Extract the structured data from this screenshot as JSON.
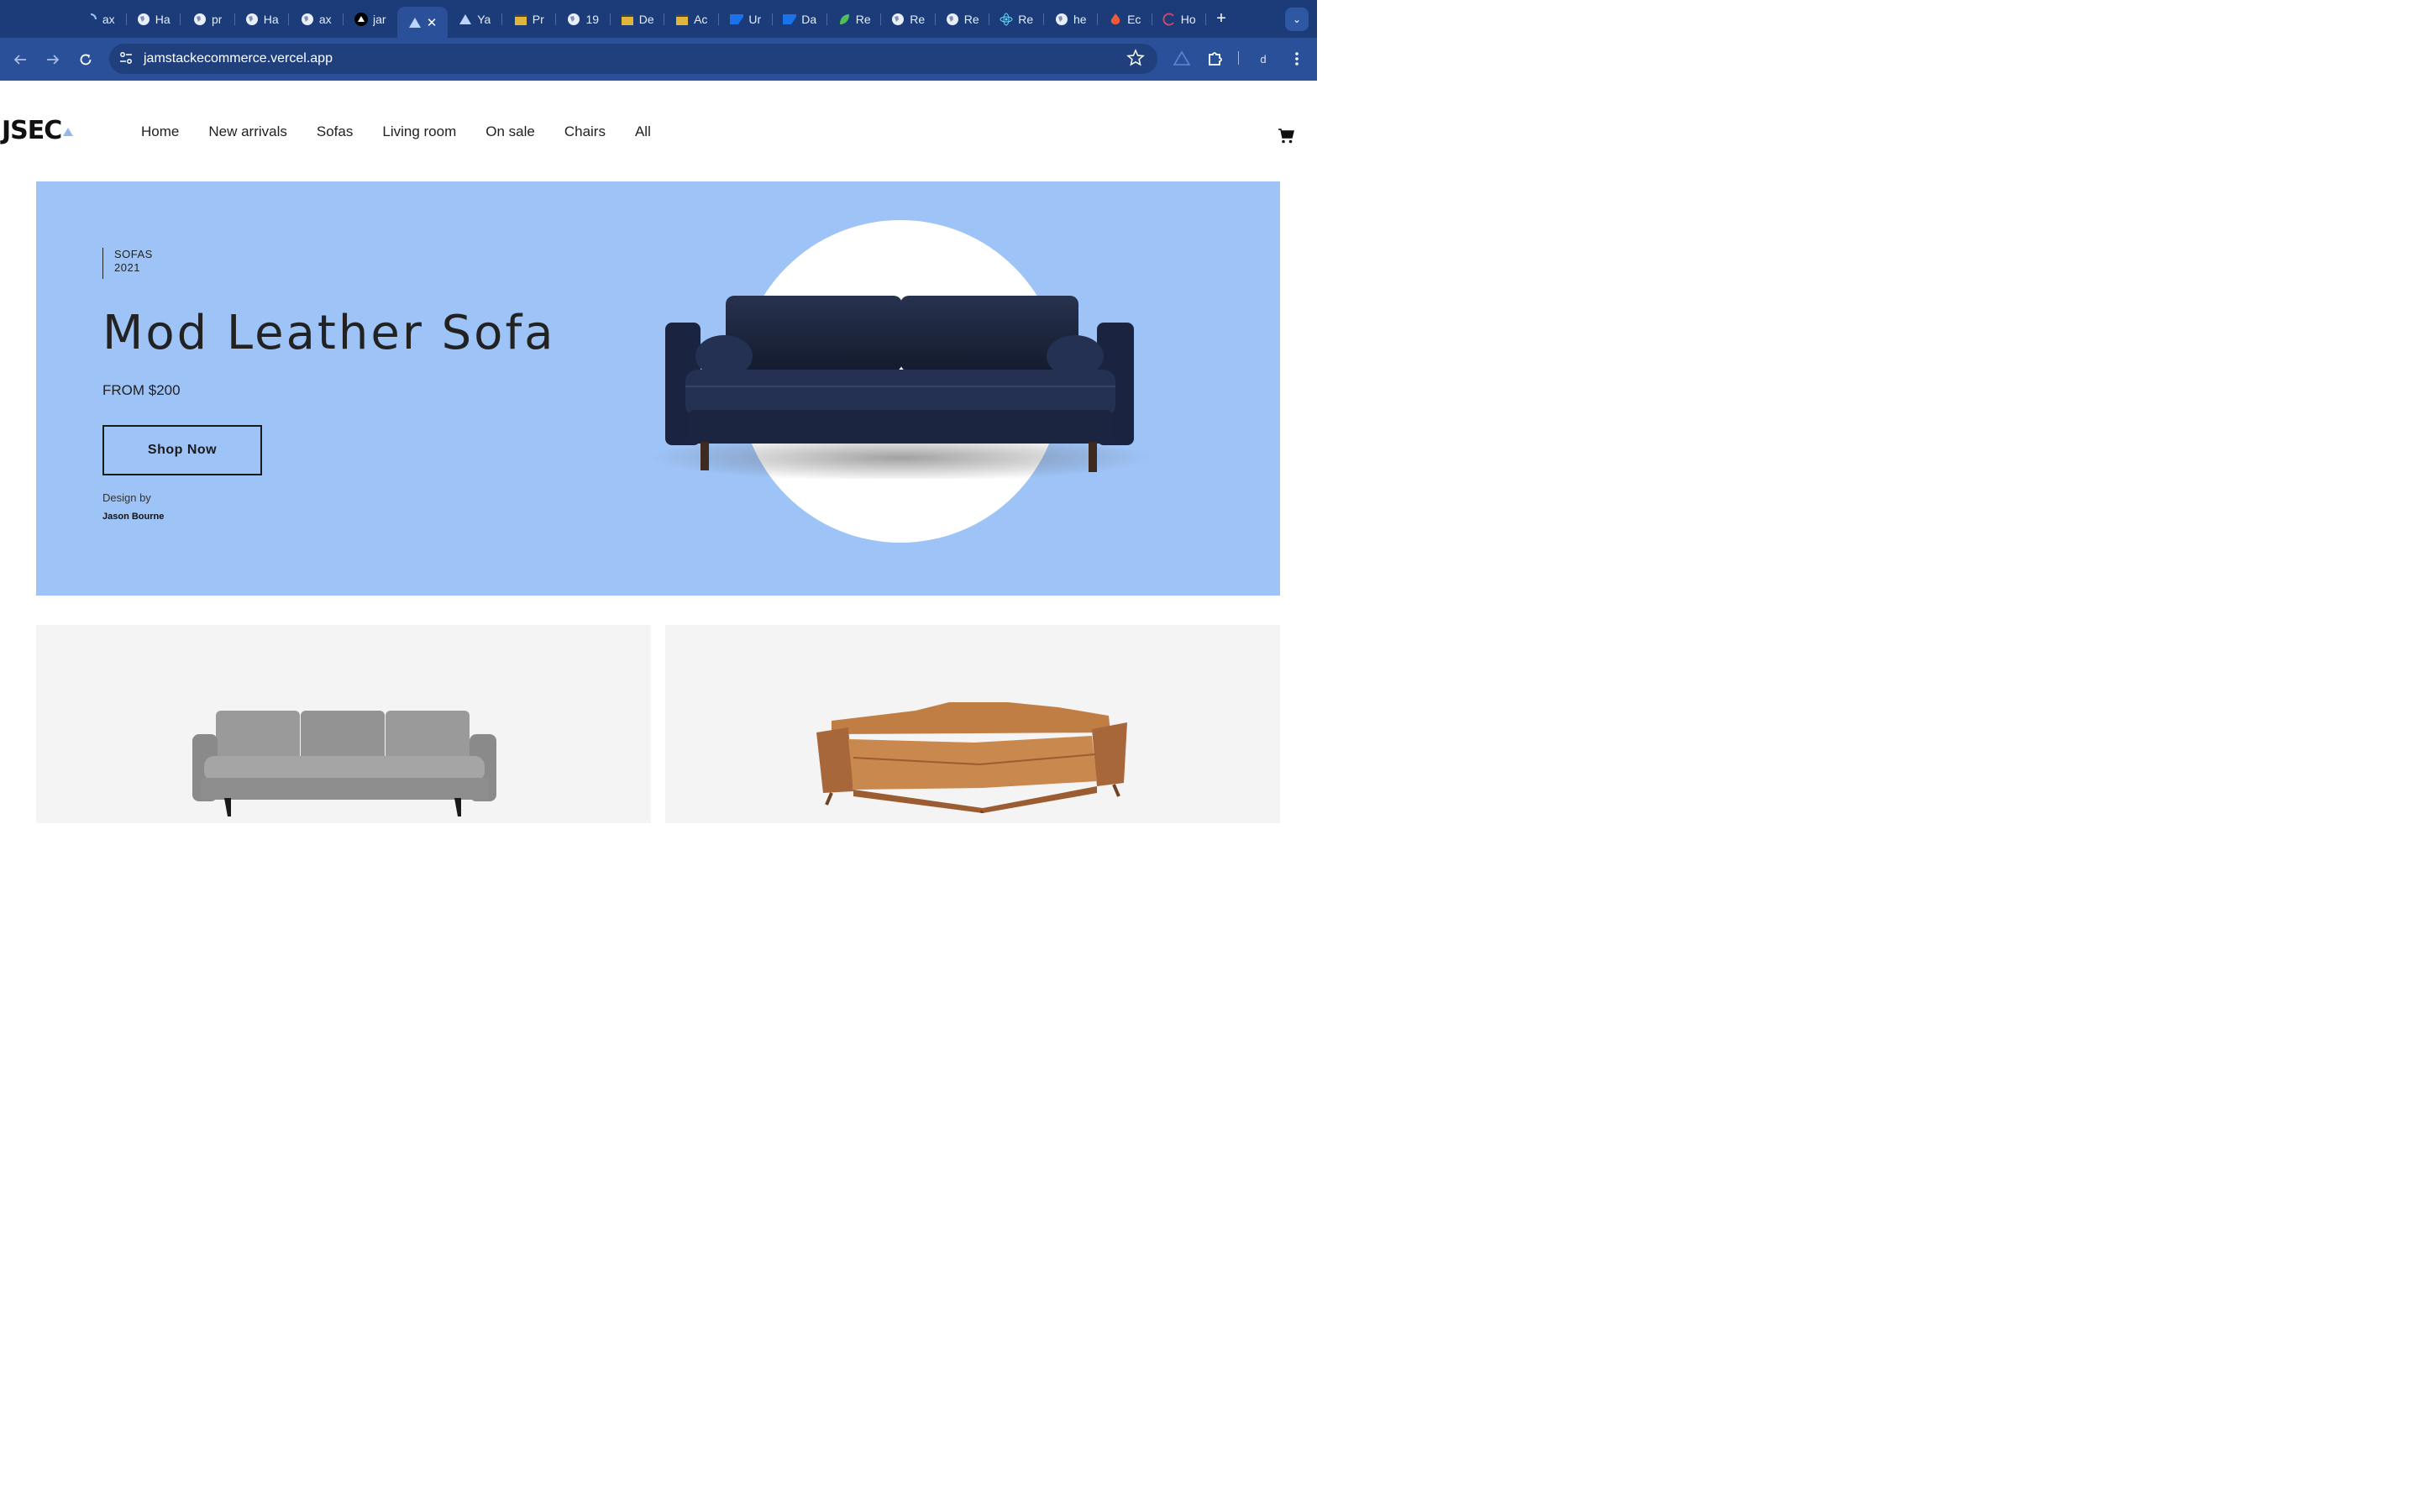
{
  "browser": {
    "tabs": [
      {
        "title": "ax",
        "icon": "loading-spinner-icon"
      },
      {
        "title": "Ha",
        "icon": "globe-icon"
      },
      {
        "title": "pr",
        "icon": "globe-icon"
      },
      {
        "title": "Ha",
        "icon": "globe-icon"
      },
      {
        "title": "ax",
        "icon": "globe-icon"
      },
      {
        "title": "jar",
        "icon": "black-triangle-icon"
      },
      {
        "title": "",
        "icon": "vercel-triangle-icon",
        "active": true
      },
      {
        "title": "Ya",
        "icon": "vercel-triangle-icon"
      },
      {
        "title": "Pr",
        "icon": "movie-clapper-icon"
      },
      {
        "title": "19",
        "icon": "globe-icon"
      },
      {
        "title": "De",
        "icon": "movie-clapper-icon"
      },
      {
        "title": "Ac",
        "icon": "movie-clapper-icon"
      },
      {
        "title": "Ur",
        "icon": "sap-icon"
      },
      {
        "title": "Da",
        "icon": "sap-icon"
      },
      {
        "title": "Re",
        "icon": "green-leaf-icon"
      },
      {
        "title": "Re",
        "icon": "globe-icon"
      },
      {
        "title": "Re",
        "icon": "globe-icon"
      },
      {
        "title": "Re",
        "icon": "react-atom-icon"
      },
      {
        "title": "he",
        "icon": "globe-icon"
      },
      {
        "title": "Ec",
        "icon": "firebase-flame-icon"
      },
      {
        "title": "Ho",
        "icon": "red-ring-icon"
      }
    ],
    "new_tab_label": "+",
    "tab_close_label": "✕",
    "tab_search_label": "⌄",
    "url": "jamstackecommerce.vercel.app",
    "profile_initial": "d"
  },
  "site": {
    "logo_text": "JSEC",
    "nav": [
      "Home",
      "New arrivals",
      "Sofas",
      "Living room",
      "On sale",
      "Chairs",
      "All"
    ]
  },
  "hero": {
    "tag_line_1": "SOFAS",
    "tag_line_2": "2021",
    "title": "Mod Leather Sofa",
    "price": "FROM $200",
    "cta_label": "Shop Now",
    "design_by_label": "Design by",
    "designer": "Jason Bourne"
  },
  "colors": {
    "tab_strip": "#1b3c78",
    "toolbar": "#2a5099",
    "hero_bg": "#9ec3f6",
    "card_bg": "#f4f4f4",
    "sofa_navy": "#1b2540",
    "sofa_grey": "#8e8e8e",
    "sofa_tan": "#b8743e"
  }
}
